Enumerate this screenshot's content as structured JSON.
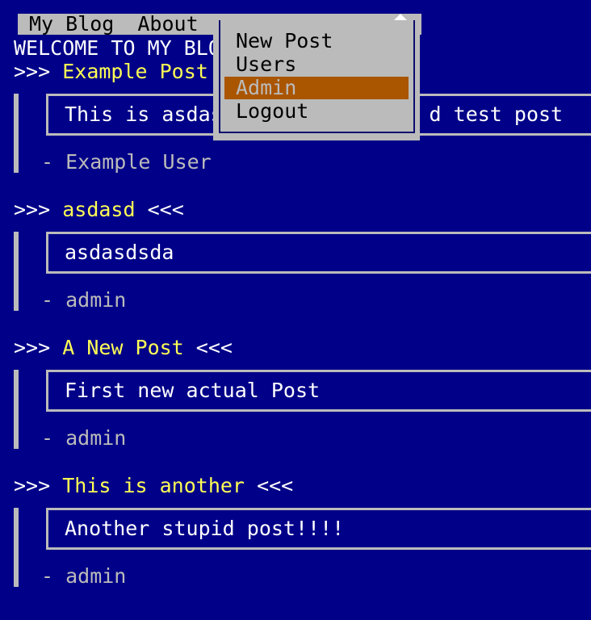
{
  "menubar": {
    "home_label": "My Blog",
    "about_label": "About"
  },
  "welcome": "WELCOME TO MY BLOG",
  "dropdown": {
    "items": [
      {
        "label": "New Post"
      },
      {
        "label": "Users"
      },
      {
        "label": "Admin",
        "active": true
      },
      {
        "label": "Logout"
      }
    ],
    "active_color": "#aa5500"
  },
  "posts": [
    {
      "prefix": ">>>",
      "title": "Example Post",
      "suffix": "<<<",
      "body": "This is asdasdasd... a longer d test post",
      "author": "- Example User"
    },
    {
      "prefix": ">>>",
      "title": "asdasd",
      "suffix": "<<<",
      "body": "asdasdsda",
      "author": "- admin"
    },
    {
      "prefix": ">>>",
      "title": "A New Post",
      "suffix": "<<<",
      "body": "First new actual Post",
      "author": "- admin"
    },
    {
      "prefix": ">>>",
      "title": "This is another",
      "suffix": "<<<",
      "body": "Another stupid post!!!!",
      "author": "- admin"
    }
  ],
  "colors": {
    "background": "#000088",
    "menu_bg": "#bbbbbb",
    "title": "#ffff55",
    "author": "#bbbbbb"
  }
}
